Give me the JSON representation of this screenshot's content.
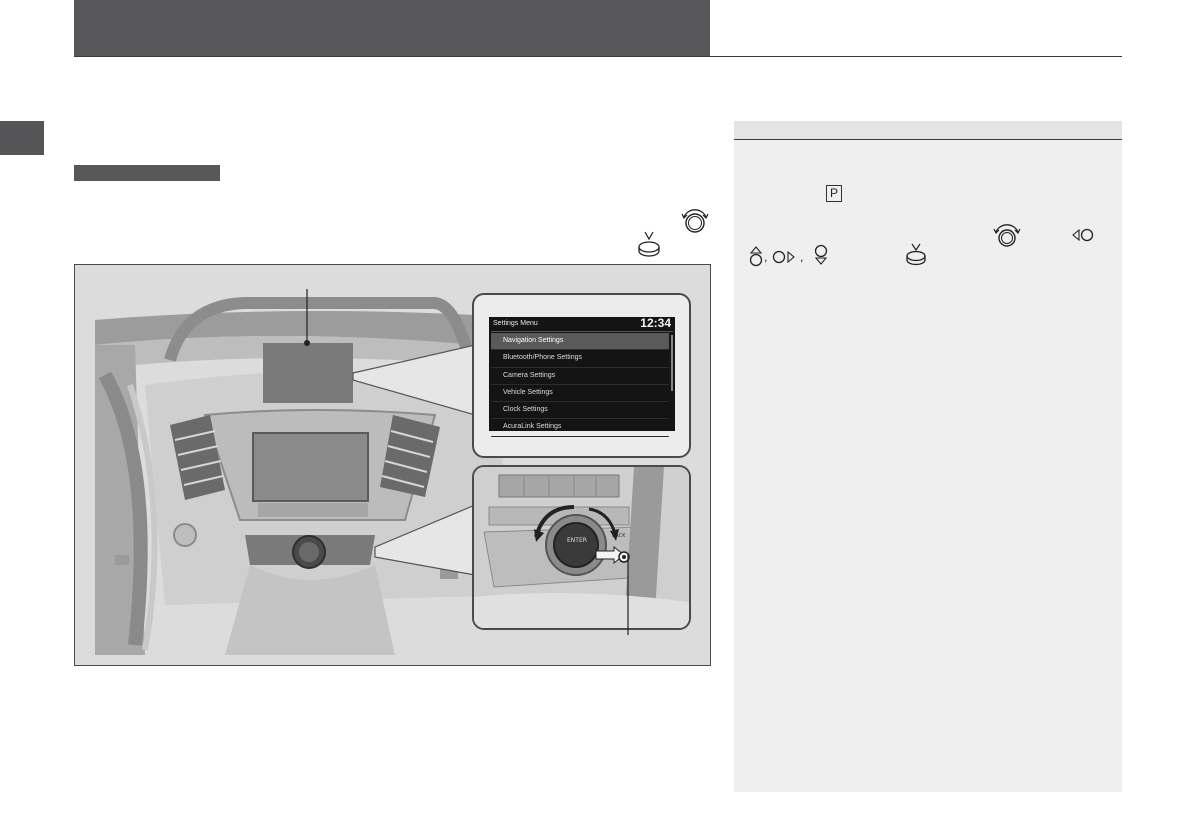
{
  "settings_menu": {
    "title": "Settings Menu",
    "time": "12:34",
    "items": [
      {
        "label": "Navigation Settings",
        "selected": true
      },
      {
        "label": "Bluetooth/Phone Settings",
        "selected": false
      },
      {
        "label": "Camera Settings",
        "selected": false
      },
      {
        "label": "Vehicle Settings",
        "selected": false
      },
      {
        "label": "Clock Settings",
        "selected": false
      },
      {
        "label": "AcuraLink Settings",
        "selected": false
      }
    ]
  },
  "controller": {
    "enter_label": "ENTER",
    "back_label": "BACK"
  },
  "note": {
    "p_symbol": "P"
  },
  "colors": {
    "header": "#58585a",
    "note_panel": "#efefef",
    "screen_bg": "#141414",
    "highlight": "#5a5a5a"
  }
}
